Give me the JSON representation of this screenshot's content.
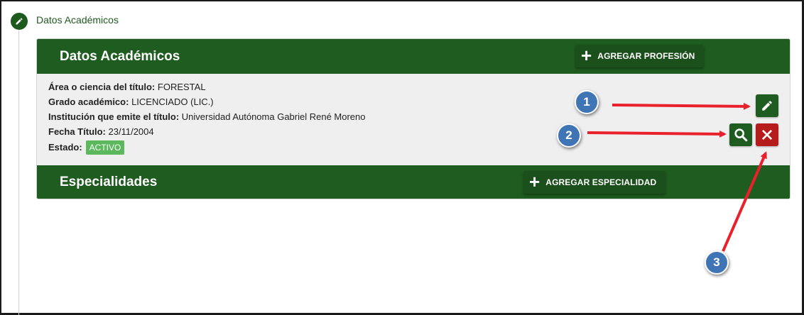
{
  "step": {
    "title": "Datos Académicos",
    "icon": "pencil-icon"
  },
  "academic": {
    "header": "Datos Académicos",
    "add_button": "AGREGAR PROFESIÓN",
    "fields": {
      "area_label": "Área o ciencia del título:",
      "area_value": "FORESTAL",
      "grado_label": "Grado académico:",
      "grado_value": "LICENCIADO (LIC.)",
      "institucion_label": "Institución que emite el título:",
      "institucion_value": "Universidad Autónoma Gabriel René Moreno",
      "fecha_label": "Fecha Título:",
      "fecha_value": "23/11/2004",
      "estado_label": "Estado:",
      "estado_value": "ACTIVO"
    },
    "actions": {
      "edit_icon": "pencil-icon",
      "view_icon": "search-icon",
      "delete_icon": "close-icon"
    }
  },
  "specialties": {
    "header": "Especialidades",
    "add_button": "AGREGAR ESPECIALIDAD"
  },
  "annotations": {
    "markers": [
      "1",
      "2",
      "3"
    ],
    "arrow_color": "#e8212b",
    "marker_color": "#3f74b5"
  },
  "colors": {
    "primary_green": "#1f5c1f",
    "danger_red": "#b71c1c",
    "badge_green": "#5cb85c"
  }
}
